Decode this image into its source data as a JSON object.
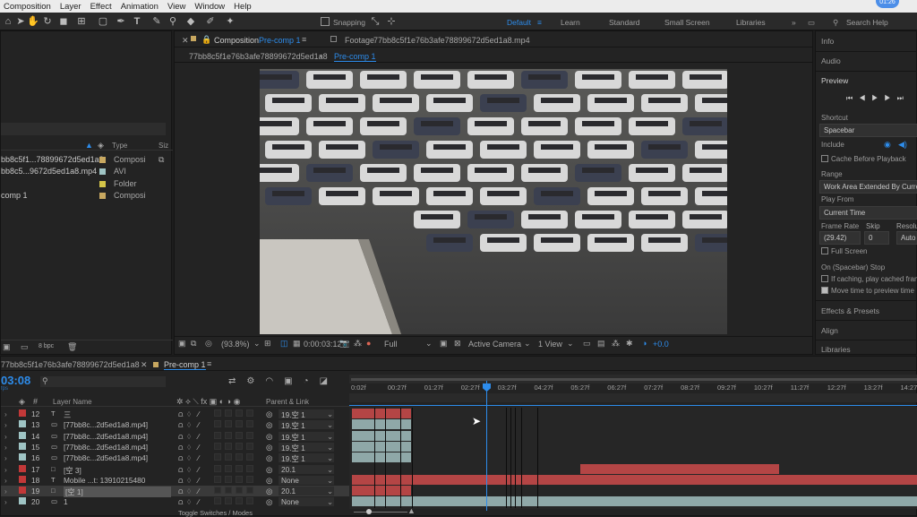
{
  "menu": [
    "Composition",
    "Layer",
    "Effect",
    "Animation",
    "View",
    "Window",
    "Help"
  ],
  "clock": "01:26",
  "toolbar": {
    "snapping": "Snapping",
    "workspaces": [
      "Default",
      "Learn",
      "Standard",
      "Small Screen",
      "Libraries"
    ],
    "search": "Search Help"
  },
  "project": {
    "cols": {
      "type": "Type",
      "size": "Siz"
    },
    "items": [
      {
        "name": "bb8c5f1...78899672d5ed1a8",
        "type": "Composi"
      },
      {
        "name": "bb8c5...9672d5ed1a8.mp4",
        "type": "AVI"
      },
      {
        "name": "",
        "type": "Folder"
      },
      {
        "name": "comp 1",
        "type": "Composi"
      }
    ],
    "bpc": "8 bpc"
  },
  "viewer": {
    "tabs": {
      "comp": "Composition",
      "comp_name": "Pre-comp 1",
      "footage": "Footage",
      "footage_name": "77bb8c5f1e76b3afe78899672d5ed1a8.mp4"
    },
    "crumbs": [
      "77bb8c5f1e76b3afe78899672d5ed1a8",
      "Pre-comp 1"
    ],
    "zoom": "(93.8%)",
    "timecode": "0:00:03:12",
    "res": "Full",
    "camera": "Active Camera",
    "view": "1 View",
    "exposure": "+0.0"
  },
  "right": {
    "info": "Info",
    "audio": "Audio",
    "preview": "Preview",
    "shortcut_label": "Shortcut",
    "shortcut": "Spacebar",
    "include": "Include",
    "cache": "Cache Before Playback",
    "range_label": "Range",
    "range": "Work Area Extended By Curre",
    "playfrom_label": "Play From",
    "playfrom": "Current Time",
    "fr_label": "Frame Rate",
    "skip_label": "Skip",
    "res_label": "Resolu",
    "fr": "(29.42)",
    "skip": "0",
    "res": "Auto",
    "fullscreen": "Full Screen",
    "stop": "On (Spacebar) Stop",
    "ifcache": "If caching, play cached fram",
    "movetime": "Move time to preview time",
    "effects": "Effects & Presets",
    "align": "Align",
    "libraries": "Libraries"
  },
  "timeline": {
    "tab": "Pre-comp 1",
    "comp_tab": "77bb8c5f1e76b3afe78899672d5ed1a8",
    "time": "03:08",
    "fps": "fps",
    "layername": "Layer Name",
    "parent": "Parent & Link",
    "toggle": "Toggle Switches / Modes",
    "ticks": [
      "0:02f",
      "00:27f",
      "01:27f",
      "02:27f",
      "03:27f",
      "04:27f",
      "05:27f",
      "06:27f",
      "07:27f",
      "08:27f",
      "09:27f",
      "10:27f",
      "11:27f",
      "12:27f",
      "13:27f",
      "14:27f"
    ],
    "layers": [
      {
        "num": "12",
        "type": "T",
        "name": "三",
        "parent": "19.空 1",
        "color": "#c23838"
      },
      {
        "num": "13",
        "type": "▭",
        "name": "[77bb8c...2d5ed1a8.mp4]",
        "parent": "19.空 1",
        "color": "#9fc4c4"
      },
      {
        "num": "14",
        "type": "▭",
        "name": "[77bb8c...2d5ed1a8.mp4]",
        "parent": "19.空 1",
        "color": "#9fc4c4"
      },
      {
        "num": "15",
        "type": "▭",
        "name": "[77bb8c...2d5ed1a8.mp4]",
        "parent": "19.空 1",
        "color": "#9fc4c4"
      },
      {
        "num": "16",
        "type": "▭",
        "name": "[77bb8c...2d5ed1a8.mp4]",
        "parent": "19.空 1",
        "color": "#9fc4c4"
      },
      {
        "num": "17",
        "type": "□",
        "name": "[空 3]",
        "parent": "20.1",
        "color": "#c23838"
      },
      {
        "num": "18",
        "type": "T",
        "name": "Mobile ...t: 13910215480",
        "parent": "None",
        "color": "#c23838"
      },
      {
        "num": "19",
        "type": "□",
        "name": "[空 1]",
        "parent": "20.1",
        "color": "#c23838"
      },
      {
        "num": "20",
        "type": "▭",
        "name": "1",
        "parent": "None",
        "color": "#9fc4c4"
      }
    ]
  }
}
